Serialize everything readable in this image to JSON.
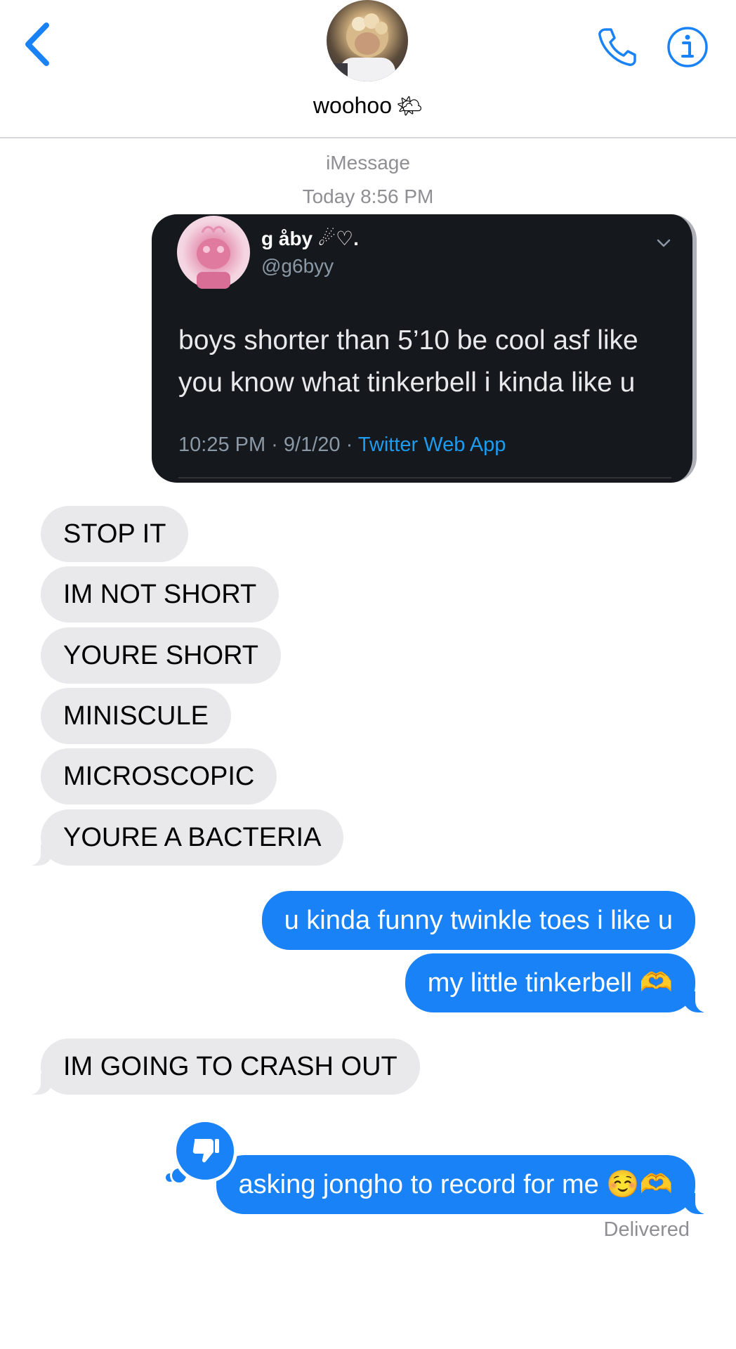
{
  "header": {
    "contact_name": "woohoo",
    "contact_emoji": "🌤",
    "accent_color": "#1a82f7"
  },
  "conversation": {
    "service": "iMessage",
    "timestamp": "Today 8:56 PM"
  },
  "tweet": {
    "display_name": "g åby ☄♡.",
    "handle": "@g6byy",
    "text": "boys shorter than 5’10 be cool asf like you know what tinkerbell  i kinda like u",
    "meta_time": "10:25 PM · 9/1/20 · ",
    "meta_app": "Twitter Web App",
    "caret_icon": "chevron-down-icon"
  },
  "messages": [
    {
      "from": "them",
      "text": "STOP IT"
    },
    {
      "from": "them",
      "text": "IM NOT SHORT"
    },
    {
      "from": "them",
      "text": "YOURE SHORT"
    },
    {
      "from": "them",
      "text": "MINISCULE"
    },
    {
      "from": "them",
      "text": "MICROSCOPIC"
    },
    {
      "from": "them",
      "text": "YOURE A BACTERIA"
    },
    {
      "from": "me",
      "text": "u kinda funny twinkle toes i like u"
    },
    {
      "from": "me",
      "text": "my little tinkerbell 🫶"
    },
    {
      "from": "them",
      "text": "IM GOING TO CRASH OUT"
    },
    {
      "from": "me",
      "text": "asking jongho to record for me ☺️🫶",
      "tapback": "thumbs-down"
    }
  ],
  "status": {
    "delivered": "Delivered"
  },
  "colors": {
    "sent_bubble": "#1a82f7",
    "received_bubble": "#e9e9eb",
    "tweet_bg": "#15181c",
    "tweet_link": "#1d9bf0"
  }
}
